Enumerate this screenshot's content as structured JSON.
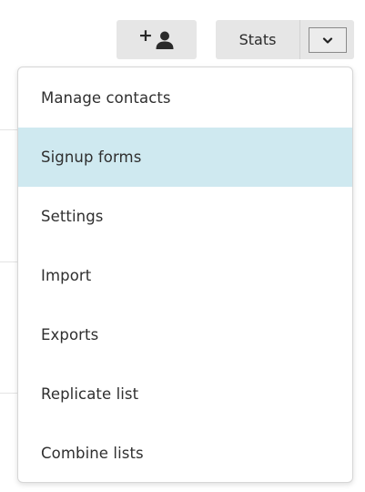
{
  "toolbar": {
    "add_contact_plus": "+",
    "stats_label": "Stats"
  },
  "icons": {
    "add_contact": "user-plus-icon",
    "toggle": "chevron-down-icon"
  },
  "menu": {
    "items": [
      {
        "label": "Manage contacts",
        "highlighted": false
      },
      {
        "label": "Signup forms",
        "highlighted": true
      },
      {
        "label": "Settings",
        "highlighted": false
      },
      {
        "label": "Import",
        "highlighted": false
      },
      {
        "label": "Exports",
        "highlighted": false
      },
      {
        "label": "Replicate list",
        "highlighted": false
      },
      {
        "label": "Combine lists",
        "highlighted": false
      }
    ]
  },
  "colors": {
    "highlight": "#cfe9f0",
    "button_bg": "#e6e6e6",
    "text": "#2f2f2f"
  }
}
